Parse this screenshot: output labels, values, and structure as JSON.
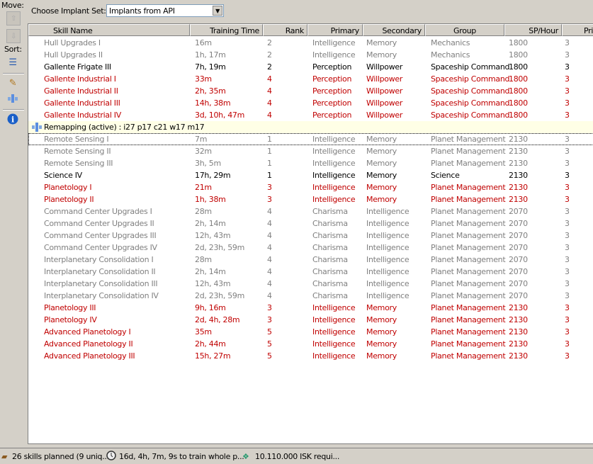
{
  "toolbar": {
    "move_label": "Move:",
    "sort_label": "Sort:"
  },
  "implant": {
    "label": "Choose Implant Set:",
    "value": "Implants from API"
  },
  "columns": [
    "Skill Name",
    "Training Time",
    "Rank",
    "Primary",
    "Secondary",
    "Group",
    "SP/Hour",
    "Pri"
  ],
  "colors": {
    "gray": "#808080",
    "red": "#c00000",
    "black": "#000000",
    "remap_bg": "#ffffe6"
  },
  "rows": [
    {
      "state": "gray",
      "cells": [
        "Hull Upgrades I",
        "16m",
        "2",
        "Intelligence",
        "Memory",
        "Mechanics",
        "1800",
        "3"
      ]
    },
    {
      "state": "gray",
      "cells": [
        "Hull Upgrades II",
        "1h, 17m",
        "2",
        "Intelligence",
        "Memory",
        "Mechanics",
        "1800",
        "3"
      ]
    },
    {
      "state": "black",
      "cells": [
        "Gallente Frigate III",
        "7h, 19m",
        "2",
        "Perception",
        "Willpower",
        "Spaceship Command",
        "1800",
        "3"
      ]
    },
    {
      "state": "red",
      "cells": [
        "Gallente Industrial I",
        "33m",
        "4",
        "Perception",
        "Willpower",
        "Spaceship Command",
        "1800",
        "3"
      ]
    },
    {
      "state": "red",
      "cells": [
        "Gallente Industrial II",
        "2h, 35m",
        "4",
        "Perception",
        "Willpower",
        "Spaceship Command",
        "1800",
        "3"
      ]
    },
    {
      "state": "red",
      "cells": [
        "Gallente Industrial III",
        "14h, 38m",
        "4",
        "Perception",
        "Willpower",
        "Spaceship Command",
        "1800",
        "3"
      ]
    },
    {
      "state": "red",
      "cells": [
        "Gallente Industrial IV",
        "3d, 10h, 47m",
        "4",
        "Perception",
        "Willpower",
        "Spaceship Command",
        "1800",
        "3"
      ]
    },
    {
      "state": "remap",
      "text": "Remapping (active) : i27 p17 c21 w17 m17"
    },
    {
      "state": "gray",
      "focus": true,
      "cells": [
        "Remote Sensing I",
        "7m",
        "1",
        "Intelligence",
        "Memory",
        "Planet Management",
        "2130",
        "3"
      ]
    },
    {
      "state": "gray",
      "cells": [
        "Remote Sensing II",
        "32m",
        "1",
        "Intelligence",
        "Memory",
        "Planet Management",
        "2130",
        "3"
      ]
    },
    {
      "state": "gray",
      "cells": [
        "Remote Sensing III",
        "3h, 5m",
        "1",
        "Intelligence",
        "Memory",
        "Planet Management",
        "2130",
        "3"
      ]
    },
    {
      "state": "black",
      "cells": [
        "Science IV",
        "17h, 29m",
        "1",
        "Intelligence",
        "Memory",
        "Science",
        "2130",
        "3"
      ]
    },
    {
      "state": "red",
      "cells": [
        "Planetology I",
        "21m",
        "3",
        "Intelligence",
        "Memory",
        "Planet Management",
        "2130",
        "3"
      ]
    },
    {
      "state": "red",
      "cells": [
        "Planetology II",
        "1h, 38m",
        "3",
        "Intelligence",
        "Memory",
        "Planet Management",
        "2130",
        "3"
      ]
    },
    {
      "state": "gray",
      "cells": [
        "Command Center Upgrades I",
        "28m",
        "4",
        "Charisma",
        "Intelligence",
        "Planet Management",
        "2070",
        "3"
      ]
    },
    {
      "state": "gray",
      "cells": [
        "Command Center Upgrades II",
        "2h, 14m",
        "4",
        "Charisma",
        "Intelligence",
        "Planet Management",
        "2070",
        "3"
      ]
    },
    {
      "state": "gray",
      "cells": [
        "Command Center Upgrades III",
        "12h, 43m",
        "4",
        "Charisma",
        "Intelligence",
        "Planet Management",
        "2070",
        "3"
      ]
    },
    {
      "state": "gray",
      "cells": [
        "Command Center Upgrades IV",
        "2d, 23h, 59m",
        "4",
        "Charisma",
        "Intelligence",
        "Planet Management",
        "2070",
        "3"
      ]
    },
    {
      "state": "gray",
      "cells": [
        "Interplanetary Consolidation I",
        "28m",
        "4",
        "Charisma",
        "Intelligence",
        "Planet Management",
        "2070",
        "3"
      ]
    },
    {
      "state": "gray",
      "cells": [
        "Interplanetary Consolidation II",
        "2h, 14m",
        "4",
        "Charisma",
        "Intelligence",
        "Planet Management",
        "2070",
        "3"
      ]
    },
    {
      "state": "gray",
      "cells": [
        "Interplanetary Consolidation III",
        "12h, 43m",
        "4",
        "Charisma",
        "Intelligence",
        "Planet Management",
        "2070",
        "3"
      ]
    },
    {
      "state": "gray",
      "cells": [
        "Interplanetary Consolidation IV",
        "2d, 23h, 59m",
        "4",
        "Charisma",
        "Intelligence",
        "Planet Management",
        "2070",
        "3"
      ]
    },
    {
      "state": "red",
      "cells": [
        "Planetology III",
        "9h, 16m",
        "3",
        "Intelligence",
        "Memory",
        "Planet Management",
        "2130",
        "3"
      ]
    },
    {
      "state": "red",
      "cells": [
        "Planetology IV",
        "2d, 4h, 28m",
        "3",
        "Intelligence",
        "Memory",
        "Planet Management",
        "2130",
        "3"
      ]
    },
    {
      "state": "red",
      "cells": [
        "Advanced Planetology I",
        "35m",
        "5",
        "Intelligence",
        "Memory",
        "Planet Management",
        "2130",
        "3"
      ]
    },
    {
      "state": "red",
      "cells": [
        "Advanced Planetology II",
        "2h, 44m",
        "5",
        "Intelligence",
        "Memory",
        "Planet Management",
        "2130",
        "3"
      ]
    },
    {
      "state": "red",
      "cells": [
        "Advanced Planetology III",
        "15h, 27m",
        "5",
        "Intelligence",
        "Memory",
        "Planet Management",
        "2130",
        "3"
      ]
    }
  ],
  "status": {
    "skills": "26 skills planned (9 uniq...",
    "time": "16d, 4h, 7m, 9s to train whole p...",
    "isk": "10.110.000 ISK requi..."
  }
}
